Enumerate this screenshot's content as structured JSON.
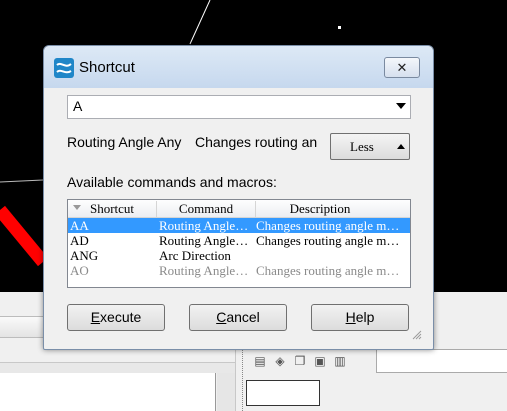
{
  "dialog": {
    "title": "Shortcut",
    "input_value": "A",
    "info_name": "Routing Angle Any",
    "info_desc": "Changes routing an",
    "less_label": "Less",
    "available_label": "Available commands and macros:",
    "columns": [
      "Shortcut",
      "Command",
      "Description"
    ],
    "rows": [
      {
        "shortcut": "AA",
        "command": "Routing Angle…",
        "description": "Changes routing angle m…",
        "selected": true
      },
      {
        "shortcut": "AD",
        "command": "Routing Angle…",
        "description": "Changes routing angle m…",
        "selected": false
      },
      {
        "shortcut": "ANG",
        "command": "Arc Direction",
        "description": "",
        "selected": false
      },
      {
        "shortcut": "AO",
        "command": "Routing Angle…",
        "description": "Changes routing angle m…",
        "selected": false
      }
    ],
    "buttons": {
      "execute": {
        "accel": "E",
        "rest": "xecute"
      },
      "cancel": {
        "accel": "C",
        "rest": "ancel"
      },
      "help": {
        "accel": "H",
        "rest": "elp"
      }
    }
  },
  "colors": {
    "canvas": "#000000",
    "selection": "#3399ff",
    "trace": "#ff0000"
  }
}
